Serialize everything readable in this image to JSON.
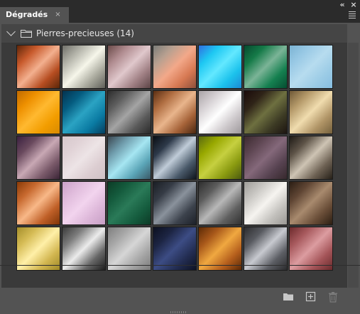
{
  "window": {
    "collapse_label": "«",
    "close_label": "×"
  },
  "tabs": [
    {
      "label": "Dégradés",
      "close_label": "×",
      "active": true
    }
  ],
  "group": {
    "label": "Pierres-precieuses (14)",
    "expanded": true
  },
  "colors": {
    "panel_bg": "#535353",
    "header_bg": "#454545",
    "swatch_area_bg": "#3a3a3a",
    "text": "#e6e6e6"
  },
  "gradients": [
    [
      "#5d2508",
      "#c85a2c",
      "#f3b08f",
      "#b64d21",
      "#5a2608"
    ],
    [
      "#6e6e68",
      "#b4b4aa",
      "#f6f6ea",
      "#a8a89c",
      "#5e5e58"
    ],
    [
      "#6a4a48",
      "#b08c90",
      "#e0c8cc",
      "#a08084",
      "#5c4446"
    ],
    [
      "#7a7c78",
      "#b8a090",
      "#f3a889",
      "#d67852",
      "#8e4f3a"
    ],
    [
      "#2f6ee0",
      "#1ec8f2",
      "#63e8ff",
      "#1cc2ec",
      "#1b8ad4"
    ],
    [
      "#05492e",
      "#157a48",
      "#7bb497",
      "#158050",
      "#054c30"
    ],
    [
      "#7bb3d3",
      "#99c9e5",
      "#b7dcef",
      "#9ccce6",
      "#86bde0"
    ],
    [
      "#c06a00",
      "#ee9000",
      "#ffb930",
      "#f29d00",
      "#d88a00"
    ],
    [
      "#04324f",
      "#055c80",
      "#2ba3c3",
      "#0a7aa2",
      "#053e5e"
    ],
    [
      "#2d2d2d",
      "#5e5e5e",
      "#a4a4a4",
      "#5a5a5a",
      "#2a2a2a"
    ],
    [
      "#5a2e12",
      "#b06e42",
      "#e9b58c",
      "#a56238",
      "#4a2710"
    ],
    [
      "#a9a3a6",
      "#d5d0d3",
      "#ffffff",
      "#cbc6c9",
      "#9d989b"
    ],
    [
      "#1a0a0a",
      "#2f2418",
      "#6e7040",
      "#3c3a24",
      "#1c1410"
    ],
    [
      "#6e5836",
      "#b59a6a",
      "#f0dcae",
      "#b09466",
      "#74603c"
    ],
    [
      "#3a2040",
      "#6a4a5e",
      "#c8a8b4",
      "#7a5a6a",
      "#3a2436"
    ],
    [
      "#d6c8cc",
      "#e0d2d6",
      "#ede4e6",
      "#dccdd1",
      "#cfc1c5"
    ],
    [
      "#3a4650",
      "#6e9aaa",
      "#a6e6f2",
      "#5aa4b6",
      "#3a5866"
    ],
    [
      "#0a0e14",
      "#2e3a4a",
      "#c0ccd8",
      "#4a5a6a",
      "#0e141c"
    ],
    [
      "#5a6a10",
      "#98a800",
      "#c6d040",
      "#8a9a10",
      "#4c5a10"
    ],
    [
      "#3c2a30",
      "#5e4652",
      "#84687a",
      "#564250",
      "#36282c"
    ],
    [
      "#1e1a16",
      "#5e5448",
      "#cec4b4",
      "#6e6254",
      "#262018"
    ],
    [
      "#8a3a06",
      "#c86a30",
      "#f8b888",
      "#c06028",
      "#7e3406"
    ],
    [
      "#c8a0c6",
      "#e0bcdc",
      "#f2d4ee",
      "#dcb6d8",
      "#c79fc5"
    ],
    [
      "#0c3c26",
      "#145a3c",
      "#2a7a58",
      "#155c3e",
      "#0c3a26"
    ],
    [
      "#1a1e24",
      "#363c46",
      "#8a929c",
      "#3c424c",
      "#1c2028"
    ],
    [
      "#2e2e2e",
      "#5c5c5c",
      "#b8b8b8",
      "#606060",
      "#303030"
    ],
    [
      "#9e9c98",
      "#c8c6c2",
      "#f6f4f0",
      "#c2c0bc",
      "#999793"
    ],
    [
      "#2c1e14",
      "#604634",
      "#a88a6e",
      "#6a4e38",
      "#2c1e12"
    ],
    [
      "#a48e2a",
      "#d6bc56",
      "#fff0a8",
      "#d2b650",
      "#9e8826"
    ],
    [
      "#3a3a3a",
      "#7c7c7c",
      "#ececec",
      "#666666",
      "#1e1e1e"
    ],
    [
      "#7e7e7e",
      "#a6a6a6",
      "#d6d6d6",
      "#a4a4a4",
      "#7a7a7a"
    ],
    [
      "#0c1020",
      "#1c2442",
      "#3c4c84",
      "#222c50",
      "#0e1222"
    ],
    [
      "#5c2a06",
      "#a8581a",
      "#f0a840",
      "#b45e1c",
      "#5a2806"
    ],
    [
      "#2c2c2e",
      "#585a60",
      "#c8cad0",
      "#5c5e64",
      "#2a2a2c"
    ],
    [
      "#6c2a2c",
      "#a85a5e",
      "#dc9ca0",
      "#a45458",
      "#6a2a2c"
    ]
  ]
}
